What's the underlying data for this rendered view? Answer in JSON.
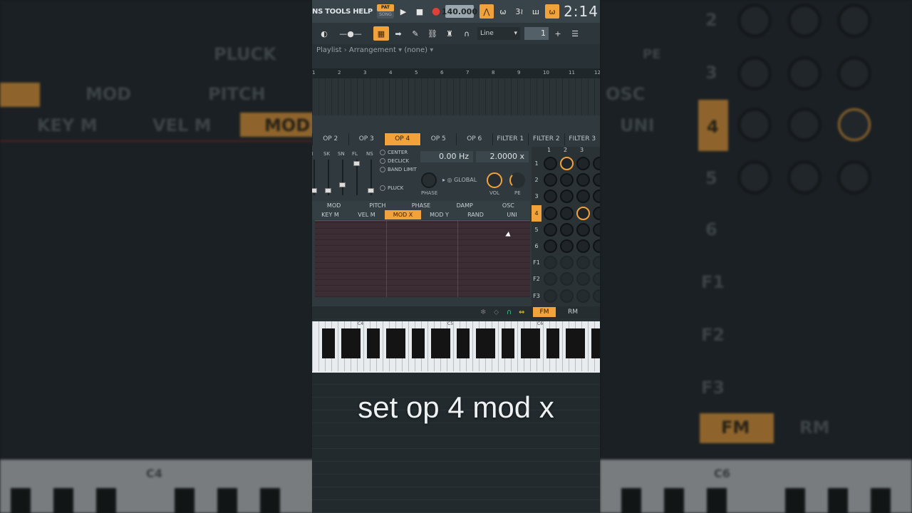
{
  "toolbar": {
    "menu": "NS TOOLS HELP",
    "pat_label": "PAT",
    "song_label": "SONG",
    "tempo": "140.000",
    "clock": "2:14"
  },
  "toolbar2": {
    "snap": "Line",
    "step_value": "1"
  },
  "playlist": {
    "title": "Playlist",
    "arrangement": "Arrangement",
    "pattern": "(none)"
  },
  "ruler": [
    "1",
    "2",
    "3",
    "4",
    "5",
    "6",
    "7",
    "8",
    "9",
    "10",
    "11",
    "12"
  ],
  "op_tabs": {
    "items": [
      "OP 2",
      "OP 3",
      "OP 4",
      "OP 5",
      "OP 6",
      "FILTER 1",
      "FILTER 2",
      "FILTER 3"
    ],
    "active": "OP 4"
  },
  "faders": [
    "N",
    "SK",
    "SN",
    "FL",
    "NS"
  ],
  "options": {
    "center": "CENTER",
    "declick": "DECLICK",
    "band_limit": "BAND LIMIT",
    "pluck": "PLUCK",
    "global": "GLOBAL"
  },
  "frequency": "0.00 Hz",
  "ratio": "2.0000 x",
  "knobs": {
    "phase": "PHASE",
    "vol": "VOL",
    "pe": "PE"
  },
  "mod_tabs_1": [
    "MOD",
    "PITCH",
    "PHASE",
    "DAMP",
    "OSC"
  ],
  "mod_tabs_2": {
    "items": [
      "KEY M",
      "VEL M",
      "MOD X",
      "MOD Y",
      "RAND",
      "UNI"
    ],
    "active": "MOD X"
  },
  "matrix": {
    "columns": [
      "1",
      "2",
      "3"
    ],
    "rows": [
      "1",
      "2",
      "3",
      "4",
      "5",
      "6",
      "F1",
      "F2",
      "F3"
    ],
    "active_row": "4"
  },
  "bottom": {
    "fm": "FM",
    "rm": "RM"
  },
  "piano": {
    "octaves": [
      "C4",
      "C5",
      "C6"
    ]
  },
  "caption": "set op 4 mod x",
  "background": {
    "left_labels": [
      "PLUCK",
      "MOD",
      "PITCH",
      "KEY M",
      "VEL M",
      "MOD"
    ],
    "right_labels": [
      "OSC",
      "UNI",
      "PE",
      "FM",
      "RM",
      "C6"
    ],
    "right_rows": [
      "2",
      "3",
      "4",
      "5",
      "6",
      "F1",
      "F2",
      "F3"
    ],
    "left_c4": "C4"
  },
  "colors": {
    "accent": "#f2a23a",
    "panel": "#2f393e",
    "envelope": "#3c2d34"
  }
}
